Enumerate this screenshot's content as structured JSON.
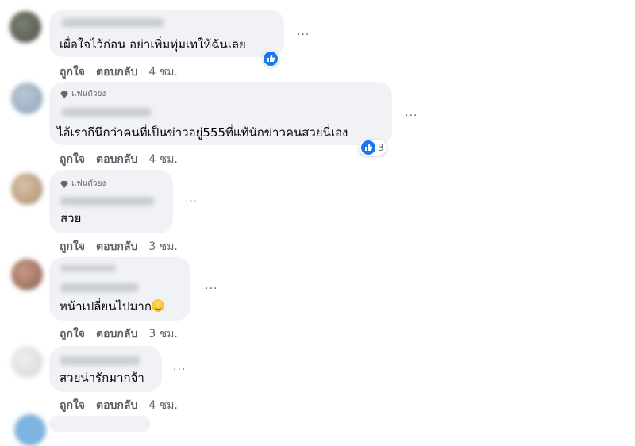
{
  "colors": {
    "bubble": "#f0f2f5",
    "like_blue": "#1877f2",
    "meta_text": "#65676b"
  },
  "comments": [
    {
      "text": "เผื่อใจไว้ก่อน อย่าเพิ่มทุ่มเทให้ฉันเลย",
      "like_label": "ถูกใจ",
      "reply_label": "ตอบกลับ",
      "time": "4 ชม.",
      "more": "···",
      "badge": "",
      "reaction_count": ""
    },
    {
      "text": "ไอ้เรากึนึกว่าคนที่เป็นข่าวอยู่555ที่แท้นักข่าวคนสวยนี่เอง",
      "like_label": "ถูกใจ",
      "reply_label": "ตอบกลับ",
      "time": "4 ชม.",
      "more": "···",
      "badge": "แฟนตัวยง",
      "reaction_count": "3"
    },
    {
      "text": "สวย",
      "like_label": "ถูกใจ",
      "reply_label": "ตอบกลับ",
      "time": "3 ชม.",
      "more": "···",
      "badge": "แฟนตัวยง",
      "reaction_count": ""
    },
    {
      "text": "หน้าเปลี่ยนไปมาก",
      "like_label": "ถูกใจ",
      "reply_label": "ตอบกลับ",
      "time": "3 ชม.",
      "more": "···",
      "badge": "",
      "reaction_count": ""
    },
    {
      "text": "สวยน่ารักมากจ้า",
      "like_label": "ถูกใจ",
      "reply_label": "ตอบกลับ",
      "time": "4 ชม.",
      "more": "···",
      "badge": "",
      "reaction_count": ""
    }
  ]
}
